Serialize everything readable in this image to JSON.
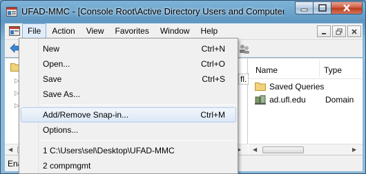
{
  "window": {
    "title": "UFAD-MMC - [Console Root\\Active Directory Users and Computers [UF..."
  },
  "menubar": {
    "items": [
      "File",
      "Action",
      "View",
      "Favorites",
      "Window",
      "Help"
    ]
  },
  "tree": {
    "visible_fragment": "fl."
  },
  "list": {
    "columns": [
      "Name",
      "Type"
    ],
    "rows": [
      {
        "name": "Saved Queries",
        "type": "",
        "icon": "folder-icon"
      },
      {
        "name": "ad.ufl.edu",
        "type": "Domain",
        "icon": "domain-icon"
      }
    ]
  },
  "status": {
    "text": "Ena"
  },
  "file_menu": {
    "items": [
      {
        "label": "New",
        "shortcut": "Ctrl+N"
      },
      {
        "label": "Open...",
        "shortcut": "Ctrl+O"
      },
      {
        "label": "Save",
        "shortcut": "Ctrl+S"
      },
      {
        "label": "Save As...",
        "shortcut": ""
      },
      {
        "label": "Add/Remove Snap-in...",
        "shortcut": "Ctrl+M"
      },
      {
        "label": "Options...",
        "shortcut": ""
      },
      {
        "label": "1 C:\\Users\\sel\\Desktop\\UFAD-MMC",
        "shortcut": ""
      },
      {
        "label": "2 compmgmt",
        "shortcut": ""
      }
    ]
  },
  "colors": {
    "accent_blue": "#5e97c2",
    "highlight": "#dce8f6",
    "close_red": "#cf5a3f"
  }
}
